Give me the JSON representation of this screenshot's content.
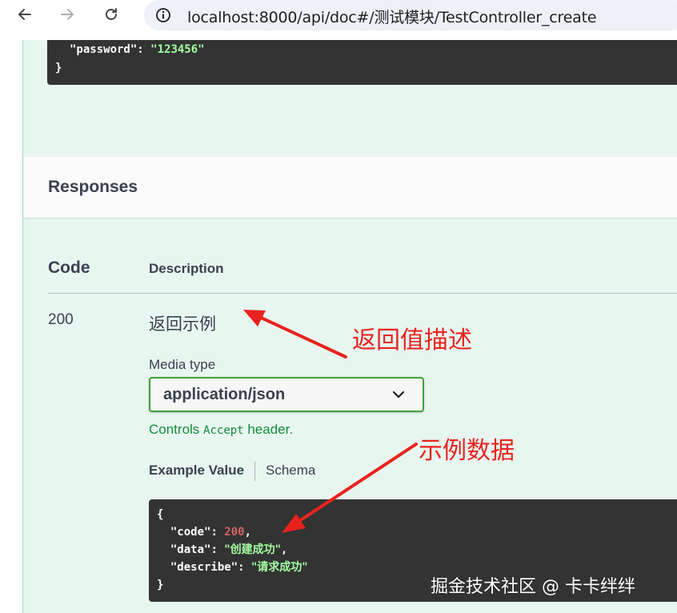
{
  "browser": {
    "url": "localhost:8000/api/doc#/测试模块/TestController_create"
  },
  "request_example": {
    "line1_key": "\"password\"",
    "line1_sep": ": ",
    "line1_value": "\"123456\"",
    "line2": "}"
  },
  "responses": {
    "title": "Responses",
    "col_code": "Code",
    "col_description": "Description",
    "row": {
      "code": "200",
      "description": "返回示例",
      "media_type_label": "Media type",
      "media_type_value": "application/json",
      "controls_prefix": "Controls ",
      "controls_code": "Accept",
      "controls_suffix": " header.",
      "tab_example": "Example Value",
      "tab_schema": "Schema"
    }
  },
  "example_value": {
    "open": "{",
    "code_key": "\"code\"",
    "code_value": "200",
    "data_key": "\"data\"",
    "data_value": "\"创建成功\"",
    "describe_key": "\"describe\"",
    "describe_value": "\"请求成功\"",
    "close": "}"
  },
  "annotations": {
    "desc_note": "返回值描述",
    "example_note": "示例数据"
  },
  "watermark": "掘金技术社区 @ 卡卡绊绊",
  "colors": {
    "accent_green": "#49cc90",
    "select_border": "#41a13a",
    "annotation_red": "#e8231e",
    "code_bg": "#333333",
    "string_green": "#a2fca2",
    "number_red": "#d36363"
  }
}
